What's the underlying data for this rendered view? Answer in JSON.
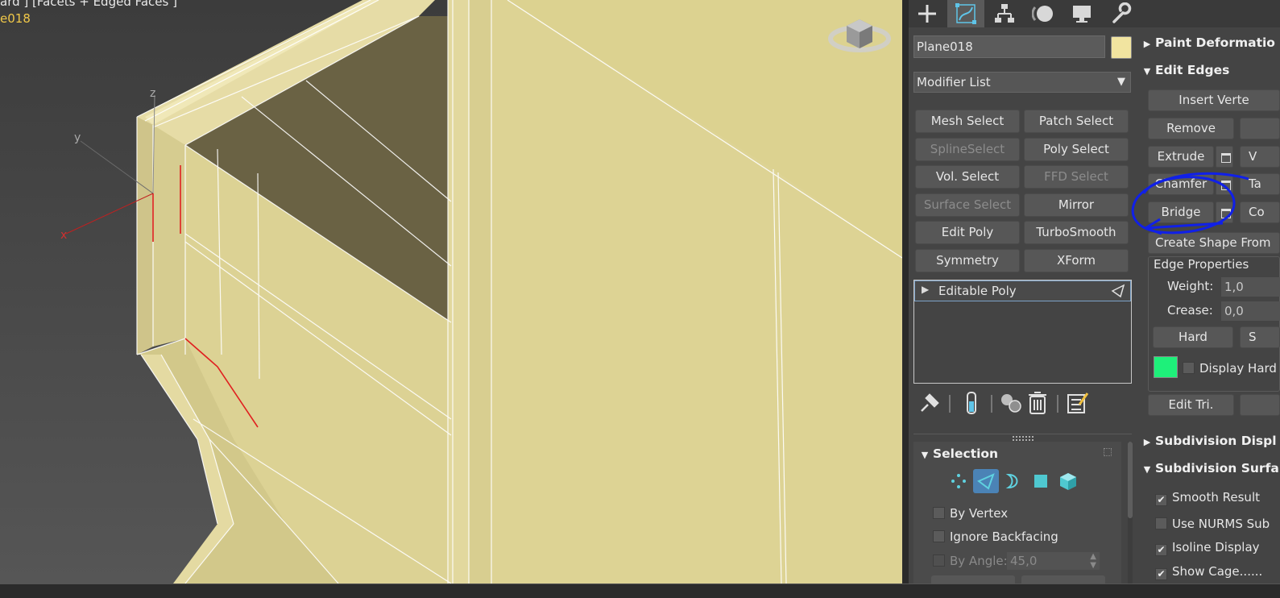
{
  "viewport": {
    "label_line1": "ard ] [Facets + Edged Faces ]",
    "label_line2": "e018",
    "axes": {
      "x": "x",
      "y": "y",
      "z": "z"
    }
  },
  "command_panel": {
    "tabs": [
      {
        "name": "create-tab",
        "icon": "plus-icon"
      },
      {
        "name": "modify-tab",
        "icon": "modify-icon",
        "active": true
      },
      {
        "name": "hierarchy-tab",
        "icon": "hierarchy-icon"
      },
      {
        "name": "motion-tab",
        "icon": "motion-icon"
      },
      {
        "name": "display-tab",
        "icon": "monitor-icon"
      },
      {
        "name": "utilities-tab",
        "icon": "wrench-icon"
      }
    ],
    "object_name": "Plane018",
    "object_color": "#f1e4a0",
    "modifier_list_label": "Modifier List",
    "modifier_buttons": [
      {
        "label": "Mesh Select",
        "enabled": true
      },
      {
        "label": "Patch Select",
        "enabled": true
      },
      {
        "label": "SplineSelect",
        "enabled": false
      },
      {
        "label": "Poly Select",
        "enabled": true
      },
      {
        "label": "Vol. Select",
        "enabled": true
      },
      {
        "label": "FFD Select",
        "enabled": false
      },
      {
        "label": "Surface Select",
        "enabled": false
      },
      {
        "label": "Mirror",
        "enabled": true
      },
      {
        "label": "Edit Poly",
        "enabled": true
      },
      {
        "label": "TurboSmooth",
        "enabled": true
      },
      {
        "label": "Symmetry",
        "enabled": true
      },
      {
        "label": "XForm",
        "enabled": true
      }
    ],
    "stack_item": "Editable Poly",
    "selection": {
      "title": "Selection",
      "by_vertex": "By Vertex",
      "ignore_backfacing": "Ignore Backfacing",
      "by_angle": "By Angle:",
      "angle_value": "45,0"
    }
  },
  "right_column": {
    "paint_deformation": "Paint Deformatio",
    "edit_edges": "Edit Edges",
    "insert_vertex": "Insert Verte",
    "remove": "Remove",
    "extrude": "Extrude",
    "weld_partial": "V",
    "chamfer": "Chamfer",
    "target_weld_partial": "Ta",
    "bridge": "Bridge",
    "connect_partial": "Co",
    "create_shape": "Create Shape From",
    "edge_properties": "Edge Properties",
    "weight_label": "Weight:",
    "weight_value": "1,0",
    "crease_label": "Crease:",
    "crease_value": "0,0",
    "hard": "Hard",
    "smooth_partial": "S",
    "display_hard": "Display Hard",
    "hard_edge_color": "#1ef07a",
    "edit_tri": "Edit Tri.",
    "subdivision_display": "Subdivision Displ",
    "subdivision_surface": "Subdivision Surfa",
    "smooth_result": "Smooth Result",
    "use_nurms": "Use NURMS Sub",
    "isoline_display": "Isoline Display",
    "show_cage": "Show Cage......"
  }
}
